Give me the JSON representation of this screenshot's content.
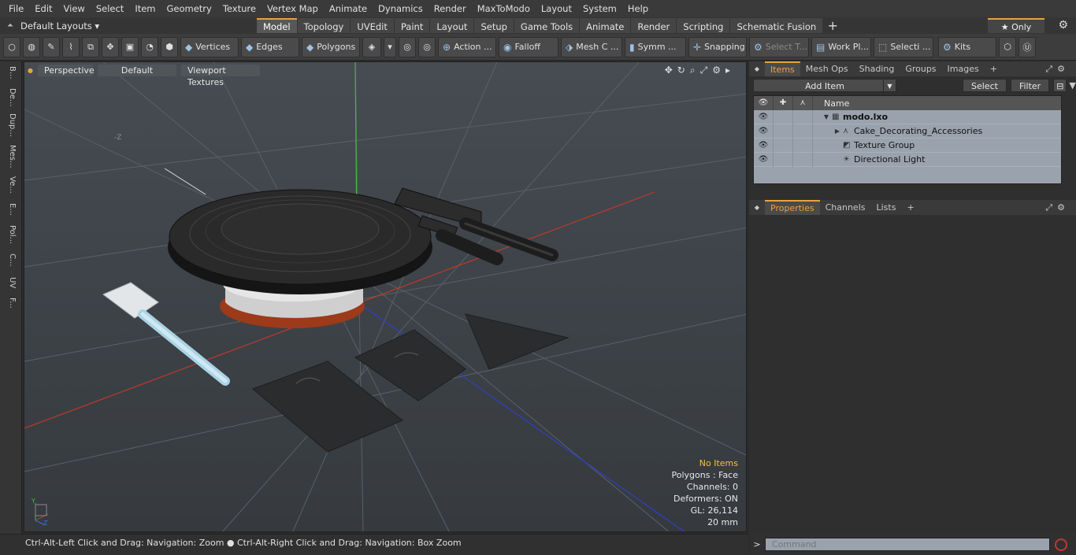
{
  "menu": [
    "File",
    "Edit",
    "View",
    "Select",
    "Item",
    "Geometry",
    "Texture",
    "Vertex Map",
    "Animate",
    "Dynamics",
    "Render",
    "MaxToModo",
    "Layout",
    "System",
    "Help"
  ],
  "layouts_label": "Default Layouts ▾",
  "tabs": [
    {
      "label": "Model",
      "active": true
    },
    {
      "label": "Topology"
    },
    {
      "label": "UVEdit"
    },
    {
      "label": "Paint"
    },
    {
      "label": "Layout"
    },
    {
      "label": "Setup"
    },
    {
      "label": "Game Tools"
    },
    {
      "label": "Animate"
    },
    {
      "label": "Render"
    },
    {
      "label": "Scripting"
    },
    {
      "label": "Schematic Fusion"
    }
  ],
  "only_label": "★  Only",
  "toolbar": {
    "vertices": "Vertices",
    "edges": "Edges",
    "polygons": "Polygons",
    "action": "Action ...",
    "falloff": "Falloff",
    "mesh": "Mesh C ...",
    "symm": "Symm ...",
    "snapping": "Snapping",
    "select_t": "Select T...",
    "work_pl": "Work Pl...",
    "selecti": "Selecti ...",
    "kits": "Kits"
  },
  "left_tabs": [
    "B...",
    "De...",
    "Dup...",
    "Mes...",
    "Ve...",
    "E...",
    "Pol...",
    "C...",
    "UV",
    "F..."
  ],
  "viewport": {
    "projection": "Perspective",
    "shading": "Default",
    "textures": "Viewport Textures",
    "axis_z_label": "-Z",
    "info": {
      "selection": "No Items",
      "polygons": "Polygons : Face",
      "channels": "Channels: 0",
      "deformers": "Deformers: ON",
      "gl": "GL: 26,114",
      "scale": "20 mm"
    }
  },
  "status_text": "Ctrl-Alt-Left Click and Drag: Navigation: Zoom ● Ctrl-Alt-Right Click and Drag: Navigation: Box Zoom",
  "items_panel": {
    "tabs": [
      {
        "label": "Items",
        "active": true
      },
      {
        "label": "Mesh Ops"
      },
      {
        "label": "Shading"
      },
      {
        "label": "Groups"
      },
      {
        "label": "Images"
      }
    ],
    "add_item": "Add Item",
    "select": "Select",
    "filter": "Filter",
    "name_header": "Name",
    "rows": [
      {
        "label": "modo.lxo",
        "bold": true,
        "indent": 0
      },
      {
        "label": "Cake_Decorating_Accessories",
        "indent": 1
      },
      {
        "label": "Texture Group",
        "indent": 1
      },
      {
        "label": "Directional Light",
        "indent": 1
      }
    ]
  },
  "props_panel": {
    "tabs": [
      {
        "label": "Properties",
        "active": true
      },
      {
        "label": "Channels"
      },
      {
        "label": "Lists"
      }
    ]
  },
  "command_placeholder": "Command"
}
